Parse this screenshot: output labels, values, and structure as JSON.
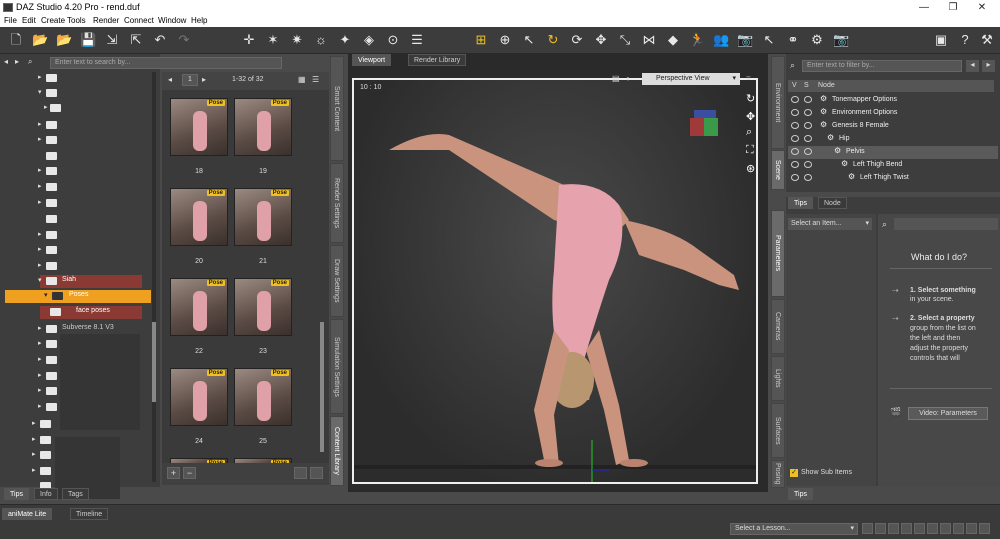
{
  "window": {
    "title": "DAZ Studio 4.20 Pro - rend.duf",
    "minimize": "—",
    "maximize": "❐",
    "close": "✕"
  },
  "menu": [
    "File",
    "Edit",
    "Create",
    "Tools",
    "Render",
    "Connect",
    "Window",
    "Help"
  ],
  "content_library": {
    "search_placeholder": "Enter text to search by...",
    "tree": [
      {
        "label": "Siah",
        "highlight": "red"
      },
      {
        "label": "Poses",
        "highlight": "orange"
      },
      {
        "label": "face poses",
        "highlight": "red"
      },
      {
        "label": "Subverse 8.1 V3",
        "highlight": "none"
      }
    ],
    "page_indicator": "1-32 of 32",
    "page_num": "1",
    "thumbnails": [
      {
        "num": "18",
        "badge": "Pose"
      },
      {
        "num": "19",
        "badge": "Pose"
      },
      {
        "num": "20",
        "badge": "Pose"
      },
      {
        "num": "21",
        "badge": "Pose"
      },
      {
        "num": "22",
        "badge": "Pose"
      },
      {
        "num": "23",
        "badge": "Pose"
      },
      {
        "num": "24",
        "badge": "Pose"
      },
      {
        "num": "25",
        "badge": "Pose"
      },
      {
        "num": "",
        "badge": "Pose"
      },
      {
        "num": "",
        "badge": "Pose"
      }
    ],
    "bottom_tabs": [
      "Tips",
      "Info",
      "Tags"
    ],
    "add_btn": "+",
    "remove_btn": "−"
  },
  "side_tabs_left": [
    "Smart Content",
    "Render Settings",
    "Draw Settings",
    "Simulation Settings",
    "Content Library"
  ],
  "viewport": {
    "tabs": [
      "Viewport",
      "Render Library"
    ],
    "view_name": "Perspective View",
    "frame_label": "10 : 10"
  },
  "scene": {
    "search_placeholder": "Enter text to filter by...",
    "header": {
      "v": "V",
      "s": "S",
      "node": "Node"
    },
    "rows": [
      {
        "label": "Tonemapper Options",
        "indent": 0
      },
      {
        "label": "Environment Options",
        "indent": 0
      },
      {
        "label": "Genesis 8 Female",
        "indent": 0
      },
      {
        "label": "Hip",
        "indent": 1
      },
      {
        "label": "Pelvis",
        "indent": 2
      },
      {
        "label": "Left Thigh Bend",
        "indent": 3
      },
      {
        "label": "Left Thigh Twist",
        "indent": 4
      }
    ]
  },
  "side_tabs_right": [
    "Environment",
    "Scene"
  ],
  "side_tabs_right2": [
    "Parameters",
    "Cameras",
    "Lights",
    "Surfaces",
    "Posing"
  ],
  "parameters": {
    "tabs": [
      "Tips",
      "Node"
    ],
    "select_item": "Select an Item...",
    "show_sub_items": "Show Sub Items",
    "help_title": "What do I do?",
    "step1_num": "1.",
    "step1_bold": "Select something",
    "step1_rest": "in your scene.",
    "step2_num": "2.",
    "step2_bold": "Select a property",
    "step2_lines": [
      "group from the list on",
      "the left and then",
      "adjust the property",
      "controls that will"
    ],
    "video_btn": "Video: Parameters",
    "bottom_tab": "Tips"
  },
  "bottom": {
    "tabs": [
      "aniMate Lite",
      "Timeline"
    ],
    "lesson": "Select a Lesson..."
  },
  "colors": {
    "accent": "#f0c020",
    "selected": "#f0a020",
    "red_row": "#8a3a32"
  }
}
